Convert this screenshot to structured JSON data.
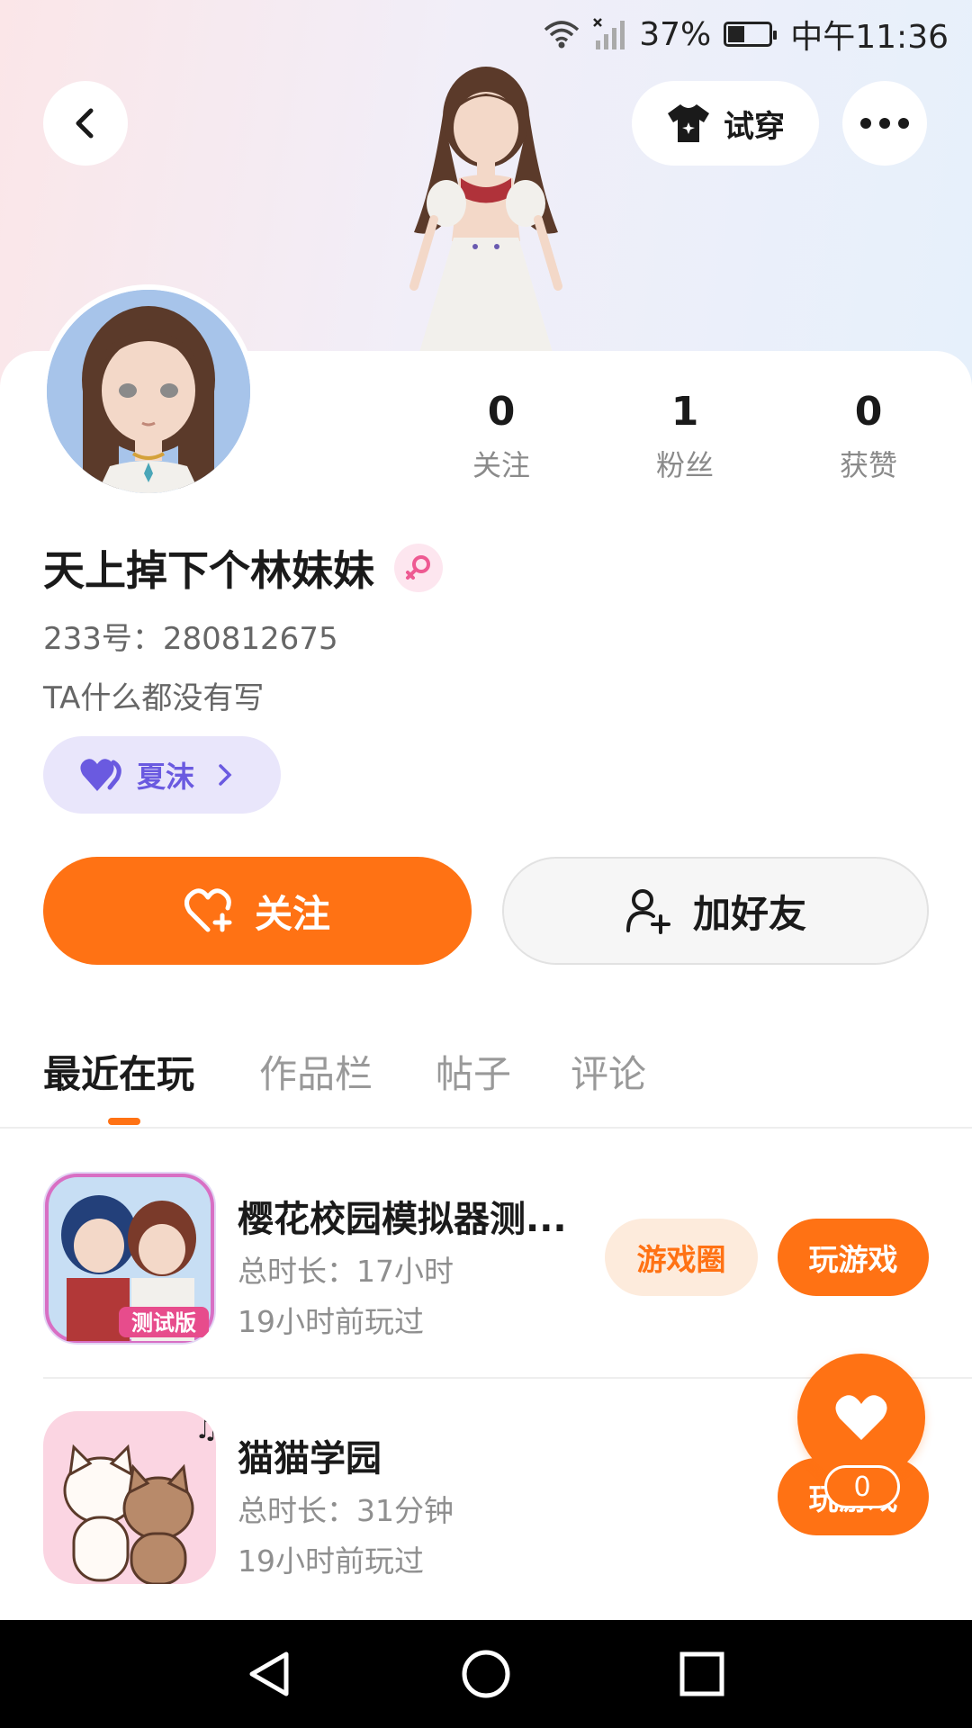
{
  "status_bar": {
    "battery": "37%",
    "time": "中午11:36"
  },
  "header": {
    "tryon_label": "试穿"
  },
  "stats": [
    {
      "num": "0",
      "label": "关注"
    },
    {
      "num": "1",
      "label": "粉丝"
    },
    {
      "num": "0",
      "label": "获赞"
    }
  ],
  "profile": {
    "nickname": "天上掉下个林妹妹",
    "uid": "233号：280812675",
    "bio": "TA什么都没有写",
    "tag": "夏沫"
  },
  "actions": {
    "follow": "关注",
    "add_friend": "加好友"
  },
  "tabs": [
    {
      "label": "最近在玩",
      "active": true
    },
    {
      "label": "作品栏",
      "active": false
    },
    {
      "label": "帖子",
      "active": false
    },
    {
      "label": "评论",
      "active": false
    }
  ],
  "games": [
    {
      "name": "樱花校园模拟器测...",
      "duration": "总时长：17小时",
      "last_played": "19小时前玩过",
      "icon_badge": "测试版",
      "circle_label": "游戏圈",
      "play_label": "玩游戏"
    },
    {
      "name": "猫猫学园",
      "duration": "总时长：31分钟",
      "last_played": "19小时前玩过",
      "play_label": "玩游戏"
    }
  ],
  "float_like": {
    "count": "0"
  },
  "colors": {
    "accent": "#ff7214",
    "tag_bg": "#e9e6fb",
    "tag_fg": "#6a5ae0"
  },
  "icons": [
    "wifi-icon",
    "signal-icon",
    "battery-icon",
    "back-icon",
    "shirt-icon",
    "more-icon",
    "female-icon",
    "heart-icon",
    "heart-plus-icon",
    "user-plus-icon",
    "nav-back-icon",
    "nav-home-icon",
    "nav-recent-icon"
  ]
}
